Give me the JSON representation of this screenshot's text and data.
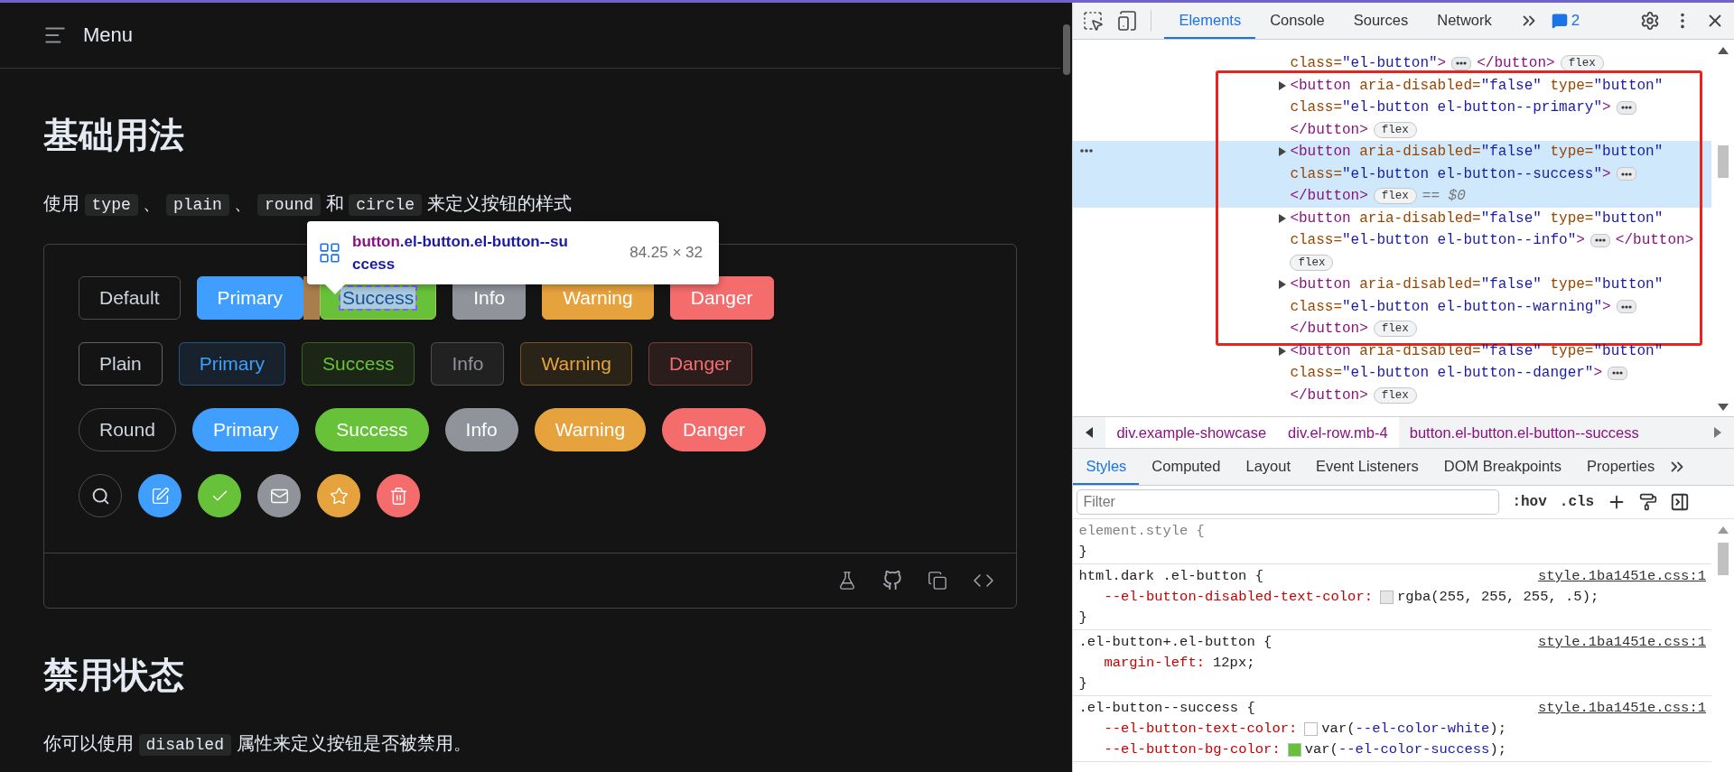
{
  "page": {
    "header": {
      "title": "Menu"
    },
    "sections": [
      {
        "heading": "基础用法",
        "paragraph": [
          {
            "text": "使用 ",
            "code": false
          },
          {
            "text": "type",
            "code": true
          },
          {
            "text": " 、 ",
            "code": false
          },
          {
            "text": "plain",
            "code": true
          },
          {
            "text": " 、 ",
            "code": false
          },
          {
            "text": "round",
            "code": true
          },
          {
            "text": " 和 ",
            "code": false
          },
          {
            "text": "circle",
            "code": true
          },
          {
            "text": " 来定义按钮的样式",
            "code": false
          }
        ],
        "demo": {
          "rows": [
            {
              "kind": "square",
              "plain": false,
              "buttons": [
                {
                  "label": "Default",
                  "kind": "default",
                  "color": "#cfd3dc",
                  "inspected": false
                },
                {
                  "label": "Primary",
                  "kind": "colored",
                  "color": "#409eff",
                  "inspected": false
                },
                {
                  "label": "Success",
                  "kind": "colored",
                  "color": "#67c23a",
                  "inspected": true
                },
                {
                  "label": "Info",
                  "kind": "colored",
                  "color": "#909399",
                  "inspected": false
                },
                {
                  "label": "Warning",
                  "kind": "colored",
                  "color": "#e6a23c",
                  "inspected": false
                },
                {
                  "label": "Danger",
                  "kind": "colored",
                  "color": "#f56c6c",
                  "inspected": false
                }
              ]
            },
            {
              "kind": "square",
              "plain": true,
              "buttons": [
                {
                  "label": "Plain",
                  "kind": "default",
                  "color": "#cfd3dc",
                  "inspected": false
                },
                {
                  "label": "Primary",
                  "kind": "colored",
                  "color": "#409eff",
                  "inspected": false
                },
                {
                  "label": "Success",
                  "kind": "colored",
                  "color": "#67c23a",
                  "inspected": false
                },
                {
                  "label": "Info",
                  "kind": "colored",
                  "color": "#909399",
                  "inspected": false
                },
                {
                  "label": "Warning",
                  "kind": "colored",
                  "color": "#e6a23c",
                  "inspected": false
                },
                {
                  "label": "Danger",
                  "kind": "colored",
                  "color": "#f56c6c",
                  "inspected": false
                }
              ]
            },
            {
              "kind": "round",
              "plain": false,
              "buttons": [
                {
                  "label": "Round",
                  "kind": "default",
                  "color": "#cfd3dc",
                  "inspected": false
                },
                {
                  "label": "Primary",
                  "kind": "colored",
                  "color": "#409eff",
                  "inspected": false
                },
                {
                  "label": "Success",
                  "kind": "colored",
                  "color": "#67c23a",
                  "inspected": false
                },
                {
                  "label": "Info",
                  "kind": "colored",
                  "color": "#909399",
                  "inspected": false
                },
                {
                  "label": "Warning",
                  "kind": "colored",
                  "color": "#e6a23c",
                  "inspected": false
                },
                {
                  "label": "Danger",
                  "kind": "colored",
                  "color": "#f56c6c",
                  "inspected": false
                }
              ]
            },
            {
              "kind": "circle",
              "plain": false,
              "buttons": [
                {
                  "kind": "default",
                  "color": "#cfd3dc",
                  "inspected": false
                },
                {
                  "kind": "colored",
                  "color": "#409eff",
                  "inspected": false
                },
                {
                  "kind": "colored",
                  "color": "#67c23a",
                  "inspected": false
                },
                {
                  "kind": "colored",
                  "color": "#909399",
                  "inspected": false
                },
                {
                  "kind": "colored",
                  "color": "#e6a23c",
                  "inspected": false
                },
                {
                  "kind": "colored",
                  "color": "#f56c6c",
                  "inspected": false
                }
              ]
            }
          ]
        }
      },
      {
        "heading": "禁用状态",
        "paragraph": [
          {
            "text": "你可以使用 ",
            "code": false
          },
          {
            "text": "disabled",
            "code": true
          },
          {
            "text": " 属性来定义按钮是否被禁用。",
            "code": false
          }
        ]
      }
    ],
    "tooltip": {
      "tag": "button",
      "class_lines": [
        ".el-button.el-button--su",
        "ccess"
      ],
      "size": "84.25 × 32"
    }
  },
  "devtools": {
    "tabs": [
      {
        "label": "Elements",
        "selected": true
      },
      {
        "label": "Console",
        "selected": false
      },
      {
        "label": "Sources",
        "selected": false
      },
      {
        "label": "Network",
        "selected": false
      }
    ],
    "issues_count": "2",
    "dom_nodes": [
      {
        "lines": [
          "class=\"el-button\">"
        ],
        "closing": "</button>",
        "closing_inline": true,
        "badge": "flex",
        "badge_inline": true,
        "selected": false,
        "boxed": false
      },
      {
        "lines": [
          "<button aria-disabled=\"false\" type=\"button\"",
          "class=\"el-button el-button--primary\">"
        ],
        "closing": "</button>",
        "closing_inline": false,
        "badge": "flex",
        "badge_inline": true,
        "expanded": false,
        "selected": false,
        "boxed": true
      },
      {
        "lines": [
          "<button aria-disabled=\"false\" type=\"button\"",
          "class=\"el-button el-button--success\">"
        ],
        "closing": "</button>",
        "closing_inline": false,
        "badge": "flex",
        "badge_inline": true,
        "expanded": false,
        "selected": true,
        "marker": "== $0",
        "boxed": true
      },
      {
        "lines": [
          "<button aria-disabled=\"false\" type=\"button\"",
          "class=\"el-button el-button--info\">"
        ],
        "closing": "</button>",
        "closing_inline": true,
        "badge": "flex",
        "badge_inline": false,
        "expanded": false,
        "selected": false,
        "boxed": true
      },
      {
        "lines": [
          "<button aria-disabled=\"false\" type=\"button\"",
          "class=\"el-button el-button--warning\">"
        ],
        "closing": "</button>",
        "closing_inline": false,
        "badge": "flex",
        "badge_inline": true,
        "expanded": false,
        "selected": false,
        "boxed": true
      },
      {
        "lines": [
          "<button aria-disabled=\"false\" type=\"button\"",
          "class=\"el-button el-button--danger\">"
        ],
        "closing": "</button>",
        "closing_inline": false,
        "badge": "flex",
        "badge_inline": true,
        "expanded": false,
        "selected": false,
        "boxed": false
      }
    ],
    "breadcrumbs": [
      {
        "label": "div.example-showcase",
        "selected": false
      },
      {
        "label": "div.el-row.mb-4",
        "selected": false
      },
      {
        "label": "button.el-button.el-button--success",
        "selected": true
      }
    ],
    "panel_tabs": [
      {
        "label": "Styles",
        "selected": true
      },
      {
        "label": "Computed",
        "selected": false
      },
      {
        "label": "Layout",
        "selected": false
      },
      {
        "label": "Event Listeners",
        "selected": false
      },
      {
        "label": "DOM Breakpoints",
        "selected": false
      },
      {
        "label": "Properties",
        "selected": false
      }
    ],
    "filter": {
      "placeholder": "Filter"
    },
    "filter_buttons": [
      ":hov",
      ".cls"
    ],
    "rules": [
      {
        "kind": "inline",
        "selector": "element.style {",
        "close": "}"
      },
      {
        "kind": "stylesheet",
        "selector": "html.dark .el-button {",
        "source": "style.1ba1451e.css:1",
        "props": [
          {
            "name": "--el-button-disabled-text-color:",
            "value": "rgba(255, 255, 255, .5);",
            "color": "#e6e6e6"
          }
        ],
        "close": "}"
      },
      {
        "kind": "stylesheet",
        "selector": ".el-button+.el-button {",
        "source": "style.1ba1451e.css:1",
        "props": [
          {
            "name": "margin-left:",
            "value": "12px;"
          }
        ],
        "close": "}"
      },
      {
        "kind": "stylesheet",
        "selector": ".el-button--success {",
        "source": "style.1ba1451e.css:1",
        "props": [
          {
            "name": "--el-button-text-color:",
            "value": "var(--el-color-white);",
            "color": "#ffffff"
          },
          {
            "name": "--el-button-bg-color:",
            "value": "var(--el-color-success);",
            "color": "#67c23a"
          }
        ]
      }
    ]
  }
}
